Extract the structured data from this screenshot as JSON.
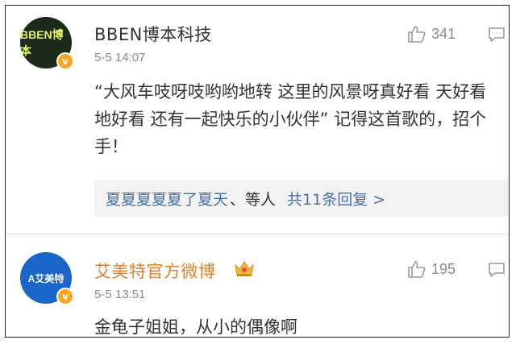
{
  "comments": [
    {
      "avatar_text": "BBEN博本",
      "name": "BBEN博本科技",
      "time": "5-5 14:07",
      "likes": "341",
      "content": "“大风车吱呀吱哟哟地转 这里的风景呀真好看 天好看 地好看 还有一起快乐的小伙伴”  记得这首歌的，招个手！",
      "replies": {
        "user": "夏夏夏夏夏了夏天",
        "others": "、等人",
        "total": "共11条回复 >"
      }
    },
    {
      "avatar_text": "A艾美特",
      "name": "艾美特官方微博",
      "time": "5-5 13:51",
      "likes": "195",
      "content": "金龟子姐姐，从小的偶像啊"
    }
  ],
  "verified_badge": "v",
  "colors": {
    "link_blue": "#4a6fa3",
    "vip_name_orange": "#e0812a",
    "meta_gray": "#8a8a8a"
  }
}
